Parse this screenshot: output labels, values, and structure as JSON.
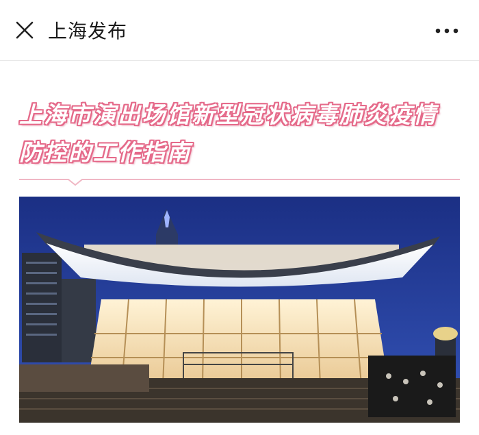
{
  "topbar": {
    "title": "上海发布",
    "close_icon": "close-icon",
    "more_icon": "more-dots-icon"
  },
  "article": {
    "title_line1": "上海市演出场馆新型冠状病毒肺炎疫情",
    "title_line2": "防控的工作指南",
    "accent_color": "#e56a8a"
  },
  "photo": {
    "subject": "Shanghai Grand Theatre at night"
  }
}
